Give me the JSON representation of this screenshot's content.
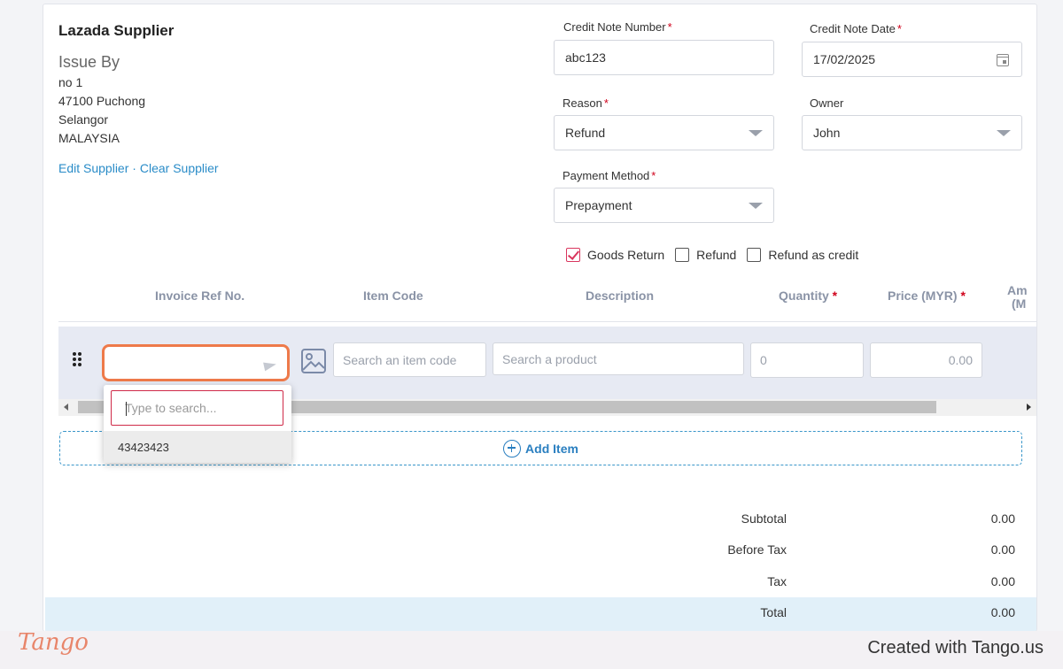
{
  "supplier": {
    "name": "Lazada Supplier",
    "issue_by": "Issue By",
    "address_lines": [
      "no 1",
      "47100 Puchong",
      "Selangor",
      "MALAYSIA"
    ],
    "edit_link": "Edit Supplier",
    "separator": "·",
    "clear_link": "Clear Supplier"
  },
  "form": {
    "credit_note_number": {
      "label": "Credit Note Number",
      "required": "*",
      "value": "abc123"
    },
    "credit_note_date": {
      "label": "Credit Note Date",
      "required": "*",
      "value": "17/02/2025"
    },
    "reason": {
      "label": "Reason",
      "required": "*",
      "value": "Refund"
    },
    "owner": {
      "label": "Owner",
      "value": "John"
    },
    "payment_method": {
      "label": "Payment Method",
      "required": "*",
      "value": "Prepayment"
    },
    "checkboxes": [
      {
        "label": "Goods Return",
        "checked": true
      },
      {
        "label": "Refund",
        "checked": false
      },
      {
        "label": "Refund as credit",
        "checked": false
      }
    ]
  },
  "table": {
    "headers": {
      "invoice_ref": "Invoice Ref No.",
      "item_code": "Item Code",
      "description": "Description",
      "quantity": "Quantity",
      "price": "Price (MYR)",
      "amount_partial_1": "Am",
      "amount_partial_2": "(M",
      "required": "*"
    },
    "row": {
      "item_code_placeholder": "Search an item code",
      "product_placeholder": "Search a product",
      "quantity": "0",
      "price": "0.00"
    },
    "add_item": "Add Item"
  },
  "dropdown": {
    "search_placeholder": "Type to search...",
    "options": [
      "43423423"
    ]
  },
  "totals": [
    {
      "label": "Subtotal",
      "value": "0.00"
    },
    {
      "label": "Before Tax",
      "value": "0.00"
    },
    {
      "label": "Tax",
      "value": "0.00"
    },
    {
      "label": "Total",
      "value": "0.00"
    }
  ],
  "colors": {
    "accent_link": "#2a8cc8",
    "focus_outline": "#ee7a4a",
    "required": "#d0021b",
    "checkbox_checked": "#d9365e",
    "total_band": "#e1f0f9"
  },
  "footer": {
    "logo": "Tango",
    "credit": "Created with Tango.us"
  }
}
